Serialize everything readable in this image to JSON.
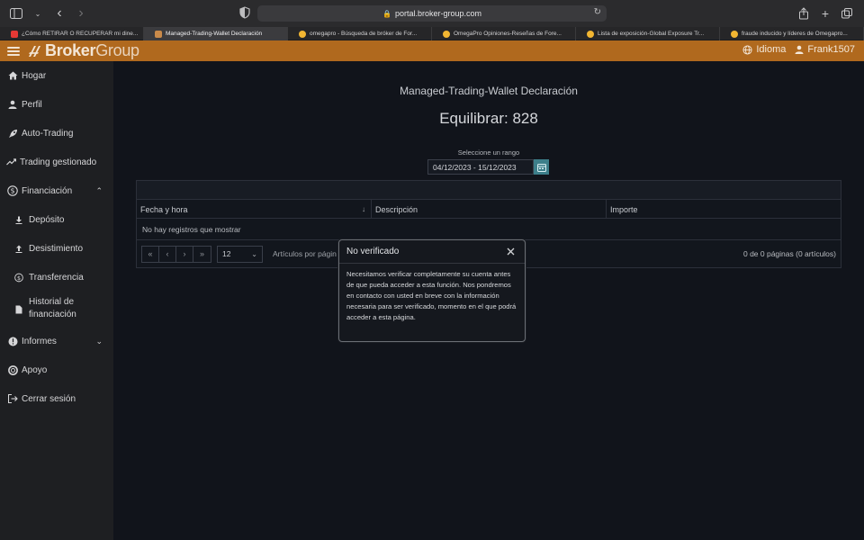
{
  "browser": {
    "url": "portal.broker-group.com",
    "tabs": [
      {
        "label": "¿Cómo RETIRAR O RECUPERAR mi dine...",
        "favicon": "youtube-favicon",
        "active": false
      },
      {
        "label": "Managed-Trading-Wallet Declaración",
        "favicon": "brokergroup-favicon",
        "active": true
      },
      {
        "label": "omegapro - Búsqueda de bróker de For...",
        "favicon": "omegapro-favicon",
        "active": false
      },
      {
        "label": "OmegaPro Opiniones-Reseñas de Fore...",
        "favicon": "omegapro-favicon",
        "active": false
      },
      {
        "label": "Lista de exposición-Global Exposure Tr...",
        "favicon": "omegapro-favicon",
        "active": false
      },
      {
        "label": "fraude inducido y líderes de Omegapro...",
        "favicon": "omegapro-favicon",
        "active": false
      }
    ]
  },
  "topbar": {
    "logo_bold": "Broker",
    "logo_light": "Group",
    "language": "Idioma",
    "username": "Frank1507",
    "color": "#b0691e"
  },
  "sidebar": {
    "items": [
      {
        "label": "Hogar",
        "icon": "home-icon"
      },
      {
        "label": "Perfil",
        "icon": "user-icon"
      },
      {
        "label": "Auto-Trading",
        "icon": "rocket-icon"
      },
      {
        "label": "Trading gestionado",
        "icon": "trend-icon"
      },
      {
        "label": "Financiación",
        "icon": "money-icon",
        "expanded": true
      },
      {
        "label": "Depósito",
        "icon": "download-icon"
      },
      {
        "label": "Desistimiento",
        "icon": "upload-icon"
      },
      {
        "label": "Transferencia",
        "icon": "transfer-icon"
      },
      {
        "label": "Historial de financiación",
        "icon": "document-icon"
      },
      {
        "label": "Informes",
        "icon": "info-icon",
        "expanded": false
      },
      {
        "label": "Apoyo",
        "icon": "support-icon"
      },
      {
        "label": "Cerrar sesión",
        "icon": "logout-icon"
      }
    ]
  },
  "main": {
    "title": "Managed-Trading-Wallet Declaración",
    "balance": "Equilibrar: 828",
    "range_label": "Seleccione un rango",
    "range_value": "04/12/2023 - 15/12/2023",
    "table": {
      "columns": [
        "Fecha y hora",
        "Descripción",
        "Importe"
      ],
      "empty_text": "No hay registros que mostrar",
      "per_page": "12",
      "per_page_label": "Artículos por págin",
      "summary": "0 de 0 páginas (0 artículos)"
    }
  },
  "modal": {
    "title": "No verificado",
    "body": "Necesitamos verificar completamente su cuenta antes de que pueda acceder a esta función. Nos pondremos en contacto con usted en breve con la información necesaria para ser verificado, momento en el que podrá acceder a esta página."
  }
}
